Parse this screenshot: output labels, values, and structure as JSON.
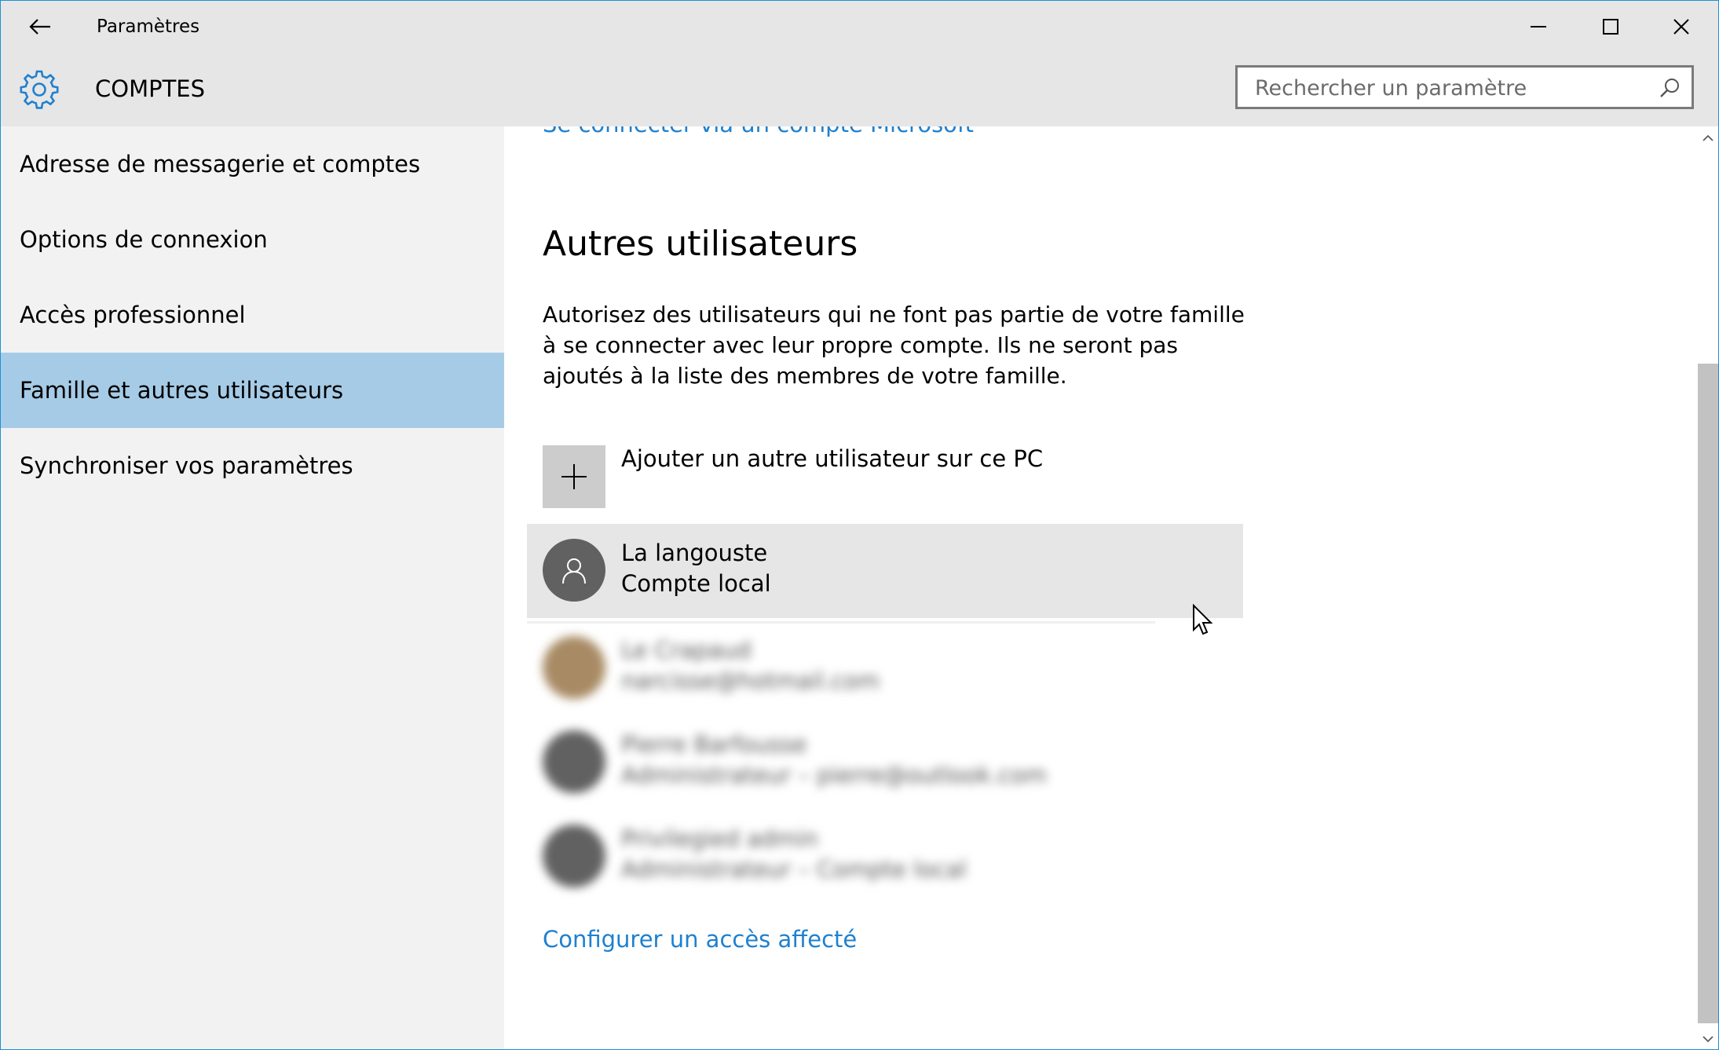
{
  "window": {
    "title": "Paramètres",
    "accent_color": "#1e90d6"
  },
  "header": {
    "section_title": "COMPTES",
    "gear_color": "#1f80cf",
    "search_placeholder": "Rechercher un paramètre"
  },
  "sidebar": {
    "items": [
      {
        "label": "Adresse de messagerie et comptes",
        "active": false
      },
      {
        "label": "Options de connexion",
        "active": false
      },
      {
        "label": "Accès professionnel",
        "active": false
      },
      {
        "label": "Famille et autres utilisateurs",
        "active": true
      },
      {
        "label": "Synchroniser vos paramètres",
        "active": false
      }
    ],
    "active_color": "#a6cbe6"
  },
  "main": {
    "top_link_partial": "Se connecter via un compte Microsoft",
    "heading": "Autres utilisateurs",
    "description": "Autorisez des utilisateurs qui ne font pas partie de votre famille à se connecter avec leur propre compte. Ils ne seront pas ajoutés à la liste des membres de votre famille.",
    "add_user_label": "Ajouter un autre utilisateur sur ce PC",
    "users": [
      {
        "name": "La langouste",
        "info": "Compte local",
        "selected": true,
        "blurred": false
      },
      {
        "name": "Le Crapaud",
        "info": "narcisse@hotmail.com",
        "selected": false,
        "blurred": true
      },
      {
        "name": "Pierre Barfousse",
        "info": "Administrateur – pierre@outlook.com",
        "selected": false,
        "blurred": true
      },
      {
        "name": "Privilegied admin",
        "info": "Administrateur – Compte local",
        "selected": false,
        "blurred": true
      }
    ],
    "assigned_access_link": "Configurer un accès affecté",
    "link_color": "#1f80cf"
  }
}
